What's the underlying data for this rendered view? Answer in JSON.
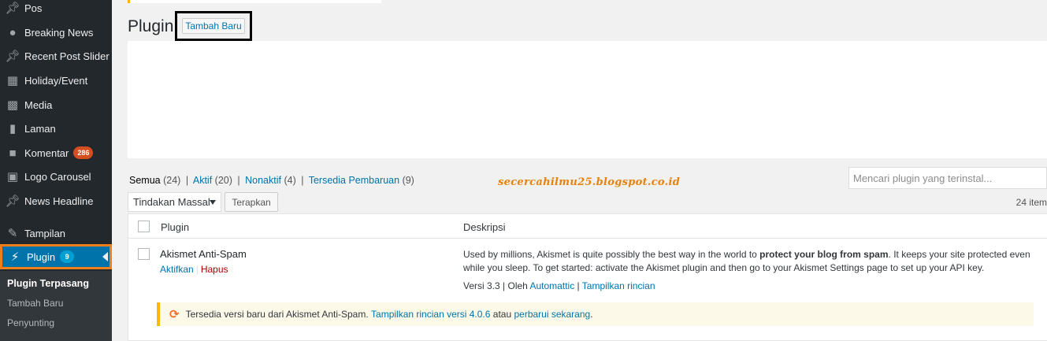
{
  "sidebar": {
    "items": [
      {
        "label": "Pos",
        "icon": "pin-icon"
      },
      {
        "label": "Breaking News",
        "icon": "lightbulb-icon"
      },
      {
        "label": "Recent Post Slider",
        "icon": "pin-icon"
      },
      {
        "label": "Holiday/Event",
        "icon": "calendar-icon"
      },
      {
        "label": "Media",
        "icon": "media-icon"
      },
      {
        "label": "Laman",
        "icon": "page-icon"
      },
      {
        "label": "Komentar",
        "icon": "comment-icon",
        "badge": "286"
      },
      {
        "label": "Logo Carousel",
        "icon": "image-icon"
      },
      {
        "label": "News Headline",
        "icon": "pin-icon"
      },
      {
        "label": "Tampilan",
        "icon": "brush-icon"
      },
      {
        "label": "Plugin",
        "icon": "plugin-icon",
        "badge": "9"
      }
    ],
    "submenu": [
      "Plugin Terpasang",
      "Tambah Baru",
      "Penyunting"
    ]
  },
  "header": {
    "title": "Plugin",
    "add_new": "Tambah Baru"
  },
  "filters": {
    "all": {
      "label": "Semua",
      "count": "(24)"
    },
    "active": {
      "label": "Aktif",
      "count": "(20)"
    },
    "inactive": {
      "label": "Nonaktif",
      "count": "(4)"
    },
    "updates": {
      "label": "Tersedia Pembaruan",
      "count": "(9)"
    },
    "separator": "|"
  },
  "watermark": "secercahilmu25.blogspot.co.id",
  "search": {
    "placeholder": "Mencari plugin yang terinstal..."
  },
  "bulk": {
    "selected": "Tindakan Massal",
    "apply": "Terapkan"
  },
  "item_count": "24 item",
  "table": {
    "col_plugin": "Plugin",
    "col_desc": "Deskripsi",
    "row": {
      "name": "Akismet Anti-Spam",
      "activate": "Aktifkan",
      "delete": "Hapus",
      "desc_before": "Used by millions, Akismet is quite possibly the best way in the world to ",
      "desc_bold": "protect your blog from spam",
      "desc_after": ". It keeps your site protected even while you sleep. To get started: activate the Akismet plugin and then go to your Akismet Settings page to set up your API key.",
      "version": "Versi 3.3 | Oleh ",
      "author": "Automattic",
      "meta_sep": " | ",
      "details": "Tampilkan rincian"
    },
    "update_notice": {
      "text": "Tersedia versi baru dari Akismet Anti-Spam. ",
      "link1": "Tampilkan rincian versi 4.0.6",
      "mid": " atau ",
      "link2": "perbarui sekarang",
      "end": "."
    }
  },
  "colors": {
    "sidebar": "#23282d",
    "accent": "#0073aa",
    "highlight_border": "#f07f1b",
    "badge": "#d54e21",
    "watermark": "#e8820c"
  }
}
